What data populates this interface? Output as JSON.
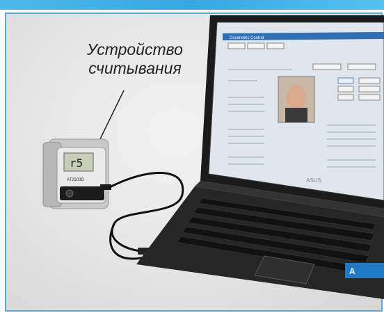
{
  "caption": {
    "line1": "Устройство",
    "line2": "считывания"
  },
  "reader": {
    "display_text": "r5",
    "model_label": "AT2503D"
  },
  "laptop": {
    "brand_label": "ASUS",
    "app_window": {
      "title": "Dosimetric Control"
    }
  },
  "colors": {
    "frame_border": "#5aa9da",
    "top_band": "#3aa6e0"
  }
}
